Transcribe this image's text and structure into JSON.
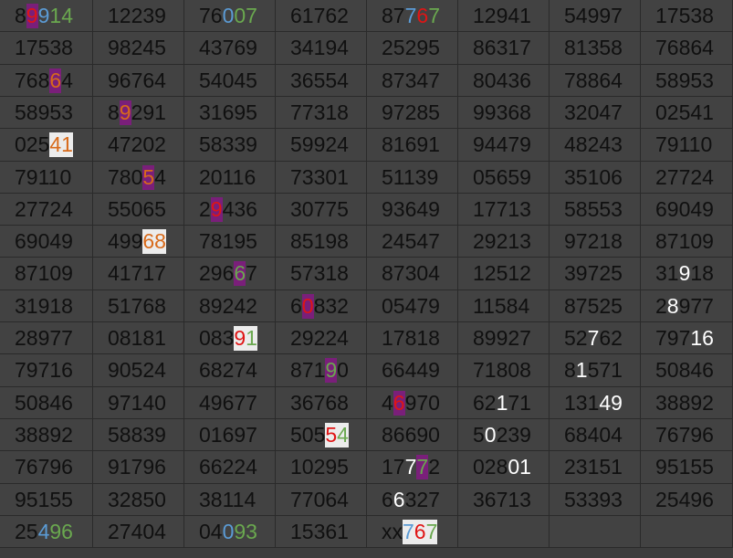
{
  "sheet": {
    "rows": [
      [
        [
          [
            "8",
            ""
          ],
          [
            "9",
            "bg-purple c-red"
          ],
          [
            "9",
            "c-blue"
          ],
          [
            "1",
            "c-green"
          ],
          [
            "4",
            "c-green"
          ]
        ],
        "12239",
        [
          [
            "76",
            ""
          ],
          [
            "0",
            "c-blue"
          ],
          [
            "07",
            "c-green"
          ]
        ],
        "61762",
        [
          [
            "87",
            ""
          ],
          [
            "7",
            "c-blue"
          ],
          [
            "6",
            "c-red"
          ],
          [
            "7",
            "c-green"
          ]
        ],
        "12941",
        "54997",
        "17538"
      ],
      [
        "17538",
        "98245",
        "43769",
        "34194",
        "25295",
        "86317",
        "81358",
        "76864"
      ],
      [
        [
          [
            "768",
            ""
          ],
          [
            "6",
            "bg-purple c-orange"
          ],
          [
            "4",
            ""
          ]
        ],
        "96764",
        "54045",
        "36554",
        "87347",
        "80436",
        "78864",
        "58953"
      ],
      [
        "58953",
        [
          [
            "8",
            ""
          ],
          [
            "9",
            "bg-purple c-orange"
          ],
          [
            "291",
            ""
          ]
        ],
        "31695",
        "77318",
        "97285",
        "99368",
        "32047",
        "02541"
      ],
      [
        [
          [
            "025",
            ""
          ],
          [
            "41",
            "bg-white c-orange"
          ]
        ],
        "47202",
        "58339",
        "59924",
        "81691",
        "94479",
        "48243",
        "79110"
      ],
      [
        "79110",
        [
          [
            "780",
            ""
          ],
          [
            "5",
            "bg-purple c-orange"
          ],
          [
            "4",
            ""
          ]
        ],
        "20116",
        "73301",
        "51139",
        "05659",
        "35106",
        "27724"
      ],
      [
        "27724",
        "55065",
        [
          [
            "2",
            ""
          ],
          [
            "9",
            "bg-purple c-red"
          ],
          [
            "436",
            ""
          ]
        ],
        "30775",
        "93649",
        "17713",
        "58553",
        "69049"
      ],
      [
        "69049",
        [
          [
            "499",
            ""
          ],
          [
            "68",
            "bg-white c-orange"
          ]
        ],
        "78195",
        "85198",
        "24547",
        "29213",
        "97218",
        "87109"
      ],
      [
        "87109",
        "41717",
        [
          [
            "296",
            ""
          ],
          [
            "6",
            "bg-purple c-green"
          ],
          [
            "7",
            ""
          ]
        ],
        "57318",
        "87304",
        "12512",
        "39725",
        [
          [
            "31",
            ""
          ],
          [
            "9",
            "c-white"
          ],
          [
            "18",
            ""
          ]
        ]
      ],
      [
        "31918",
        "51768",
        "89242",
        [
          [
            "6",
            ""
          ],
          [
            "0",
            "bg-purple c-red"
          ],
          [
            "832",
            ""
          ]
        ],
        "05479",
        "11584",
        "87525",
        [
          [
            "2",
            ""
          ],
          [
            "8",
            "c-white"
          ],
          [
            "977",
            ""
          ]
        ]
      ],
      [
        "28977",
        "08181",
        [
          [
            "083",
            ""
          ],
          [
            "9",
            "bg-white c-red"
          ],
          [
            "1",
            "bg-white c-green"
          ]
        ],
        "29224",
        "17818",
        "89927",
        [
          [
            "52",
            ""
          ],
          [
            "7",
            "c-white"
          ],
          [
            "62",
            ""
          ]
        ],
        [
          [
            "797",
            ""
          ],
          [
            "16",
            "c-white"
          ]
        ]
      ],
      [
        "79716",
        "90524",
        "68274",
        [
          [
            "871",
            ""
          ],
          [
            "9",
            "bg-purple c-green"
          ],
          [
            "0",
            ""
          ]
        ],
        "66449",
        "71808",
        [
          [
            "8",
            ""
          ],
          [
            "1",
            "c-white"
          ],
          [
            "571",
            ""
          ]
        ],
        "50846"
      ],
      [
        "50846",
        "97140",
        "49677",
        "36768",
        [
          [
            "4",
            ""
          ],
          [
            "6",
            "bg-purple c-red"
          ],
          [
            "970",
            ""
          ]
        ],
        [
          [
            "62",
            ""
          ],
          [
            "1",
            "c-white"
          ],
          [
            "71",
            ""
          ]
        ],
        [
          [
            "131",
            ""
          ],
          [
            "49",
            "c-white"
          ]
        ],
        "38892"
      ],
      [
        "38892",
        "58839",
        "01697",
        [
          [
            "505",
            ""
          ],
          [
            "5",
            "bg-white c-red"
          ],
          [
            "4",
            "bg-white c-green"
          ]
        ],
        "86690",
        [
          [
            "5",
            ""
          ],
          [
            "0",
            "c-white"
          ],
          [
            "239",
            ""
          ]
        ],
        "68404",
        "76796"
      ],
      [
        "76796",
        "91796",
        "66224",
        "10295",
        [
          [
            "17",
            ""
          ],
          [
            "7",
            "c-white"
          ],
          [
            "7",
            "bg-purple c-green"
          ],
          [
            "2",
            ""
          ]
        ],
        [
          [
            "028",
            ""
          ],
          [
            "01",
            "c-white"
          ]
        ],
        "23151",
        "95155"
      ],
      [
        "95155",
        "32850",
        "38114",
        "77064",
        [
          [
            "6",
            ""
          ],
          [
            "6",
            "c-white"
          ],
          [
            "327",
            ""
          ]
        ],
        "36713",
        "53393",
        "25496"
      ],
      [
        [
          [
            "25",
            ""
          ],
          [
            "4",
            "c-blue"
          ],
          [
            "96",
            "c-green"
          ]
        ],
        "27404",
        [
          [
            "04",
            ""
          ],
          [
            "0",
            "c-blue"
          ],
          [
            "93",
            "c-green"
          ]
        ],
        "15361",
        [
          [
            "xx",
            ""
          ],
          [
            "7",
            "bg-white c-blue"
          ],
          [
            "6",
            "bg-white c-red"
          ],
          [
            "7",
            "bg-white c-green"
          ]
        ],
        "",
        "",
        ""
      ]
    ]
  }
}
